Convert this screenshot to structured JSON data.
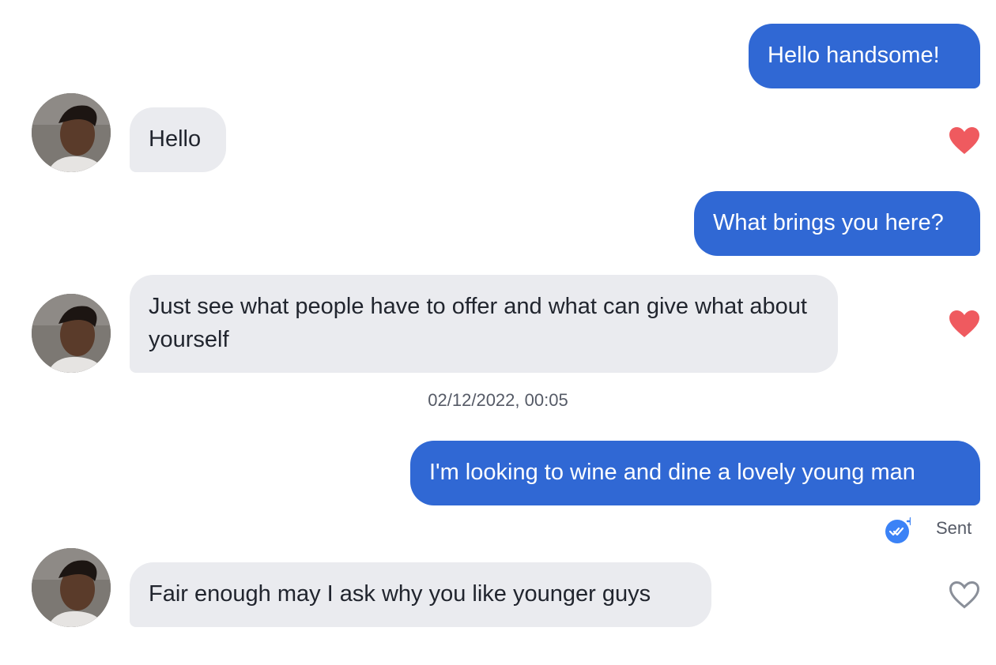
{
  "messages": [
    {
      "direction": "outgoing",
      "text": "Hello handsome!"
    },
    {
      "direction": "incoming",
      "text": "Hello",
      "liked": true
    },
    {
      "direction": "outgoing",
      "text": "What brings you here?"
    },
    {
      "direction": "incoming",
      "text": "Just see what people have to offer and what can give what about yourself",
      "liked": true
    },
    {
      "direction": "outgoing",
      "text": "I'm looking to wine and dine a lovely young man"
    },
    {
      "direction": "incoming",
      "text": "Fair enough may I ask why you like younger guys",
      "liked": false
    }
  ],
  "timestamp": "02/12/2022, 00:05",
  "receipt": {
    "status": "Sent",
    "icon": "double-check-icon"
  },
  "colors": {
    "outgoing_bubble": "#3068d4",
    "incoming_bubble": "#eaebef",
    "heart_liked": "#ef5a5f",
    "heart_unliked": "#8a8f99",
    "receipt_badge": "#3b82f6"
  }
}
